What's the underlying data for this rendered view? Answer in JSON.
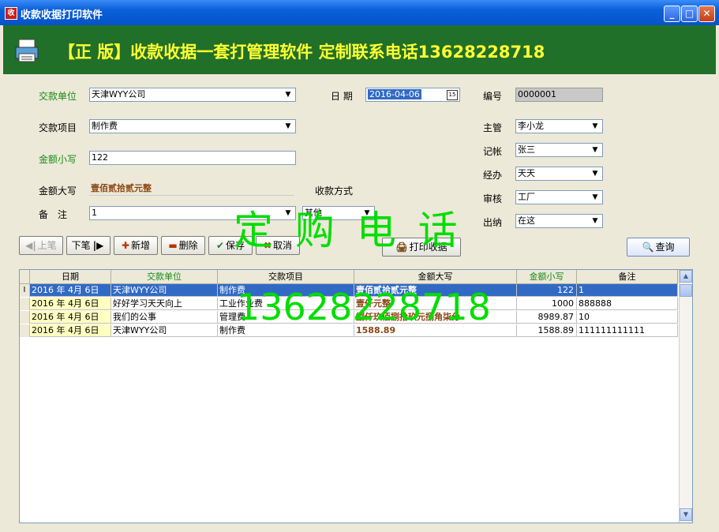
{
  "window": {
    "title": "收款收据打印软件",
    "icon": "app-icon",
    "min_label": "_",
    "max_label": "□",
    "close_label": "✕"
  },
  "banner": {
    "text": "【正 版】收款收据一套打管理软件  定制联系电话13628228718",
    "icon": "printer-icon"
  },
  "form": {
    "payer_label": "交款单位",
    "payer_value": "天津WYY公司",
    "item_label": "交款项目",
    "item_value": "制作费",
    "amount_small_label": "金额小写",
    "amount_small_value": "122",
    "amount_big_label": "金额大写",
    "amount_big_value": "壹佰贰拾贰元整",
    "remark_label": "备　注",
    "remark_value": "1",
    "date_label": "日 期",
    "date_value": "2016-04-06",
    "date_icon_label": "15",
    "method_label": "收款方式",
    "method_value": "其他",
    "number_label": "编号",
    "number_value": "0000001",
    "supervisor_label": "主管",
    "supervisor_value": "李小龙",
    "bookkeeper_label": "记帐",
    "bookkeeper_value": "张三",
    "handler_label": "经办",
    "handler_value": "天天",
    "auditor_label": "审核",
    "auditor_value": "工厂",
    "cashier_label": "出纳",
    "cashier_value": "在这"
  },
  "buttons": {
    "prev": "上笔",
    "next": "下笔",
    "add": "新增",
    "delete": "删除",
    "save": "保存",
    "cancel": "取消",
    "print": "打印收据",
    "query": "查询"
  },
  "grid": {
    "columns": [
      "日期",
      "交款单位",
      "交款项目",
      "金额大写",
      "金额小写",
      "备注"
    ],
    "rows": [
      {
        "date": "2016 年 4月 6日",
        "payer": "天津WYY公司",
        "item": "制作费",
        "amount_big": "壹佰贰拾贰元整",
        "amount_small": "122",
        "remark": "1",
        "selected": true,
        "indicator": "I"
      },
      {
        "date": "2016 年 4月 6日",
        "payer": "好好学习天天向上",
        "item": "工业作业费",
        "amount_big": "壹仟元整",
        "amount_small": "1000",
        "remark": "888888",
        "selected": false,
        "indicator": ""
      },
      {
        "date": "2016 年 4月 6日",
        "payer": "我们的公事",
        "item": "管理费",
        "amount_big": "捌仟玖佰捌拾玖元捌角柒分",
        "amount_small": "8989.87",
        "remark": "10",
        "selected": false,
        "indicator": ""
      },
      {
        "date": "2016 年 4月 6日",
        "payer": "天津WYY公司",
        "item": "制作费",
        "amount_big": "1588.89",
        "amount_small": "1588.89",
        "remark": "111111111111",
        "selected": false,
        "indicator": ""
      }
    ]
  },
  "watermark": {
    "line1": "定 购 电 话",
    "line2": "13628228718"
  },
  "colors": {
    "banner_bg": "#217029",
    "banner_text": "#ffff33",
    "watermark": "#00dd00",
    "selection": "#316ac5"
  }
}
